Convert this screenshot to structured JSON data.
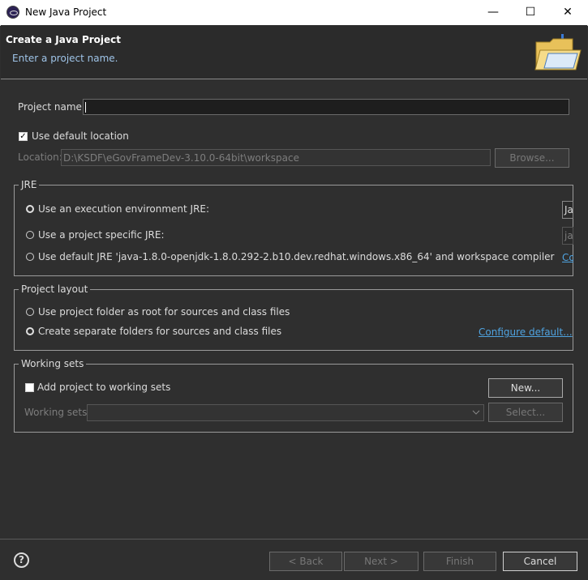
{
  "window": {
    "title": "New Java Project",
    "minimize": "—",
    "maximize": "☐",
    "close": "✕"
  },
  "header": {
    "title": "Create a Java Project",
    "subtitle": "Enter a project name."
  },
  "project": {
    "name_label": "Project name:",
    "name_value": "",
    "use_default_location_label": "Use default location",
    "use_default_location_checked": true,
    "location_label": "Location:",
    "location_value": "D:\\KSDF\\eGovFrameDev-3.10.0-64bit\\workspace",
    "browse_label": "Browse..."
  },
  "jre": {
    "legend": "JRE",
    "options": [
      {
        "label": "Use an execution environment JRE:",
        "selected": true,
        "combo_value": "Ja"
      },
      {
        "label": "Use a project specific JRE:",
        "selected": false,
        "combo_value": "ja"
      },
      {
        "label": "Use default JRE 'java-1.8.0-openjdk-1.8.0.292-2.b10.dev.redhat.windows.x86_64' and workspace compiler preferences",
        "selected": false,
        "link": "Co"
      }
    ]
  },
  "layout": {
    "legend": "Project layout",
    "options": [
      {
        "label": "Use project folder as root for sources and class files",
        "selected": false
      },
      {
        "label": "Create separate folders for sources and class files",
        "selected": true
      }
    ],
    "configure_link": "Configure default..."
  },
  "working_sets": {
    "legend": "Working sets",
    "add_label": "Add project to working sets",
    "add_checked": false,
    "new_button": "New...",
    "sets_label": "Working sets:",
    "sets_value": "",
    "select_button": "Select..."
  },
  "footer": {
    "help": "?",
    "back": "< Back",
    "next": "Next >",
    "finish": "Finish",
    "cancel": "Cancel"
  },
  "colors": {
    "background": "#2f2f2f",
    "link": "#4fa3e0",
    "subtitle": "#9fc4e8"
  },
  "icons": [
    "eclipse-app-icon",
    "folder-wizard-icon",
    "help-icon",
    "checkbox-checked-icon",
    "dropdown-arrow-icon"
  ]
}
